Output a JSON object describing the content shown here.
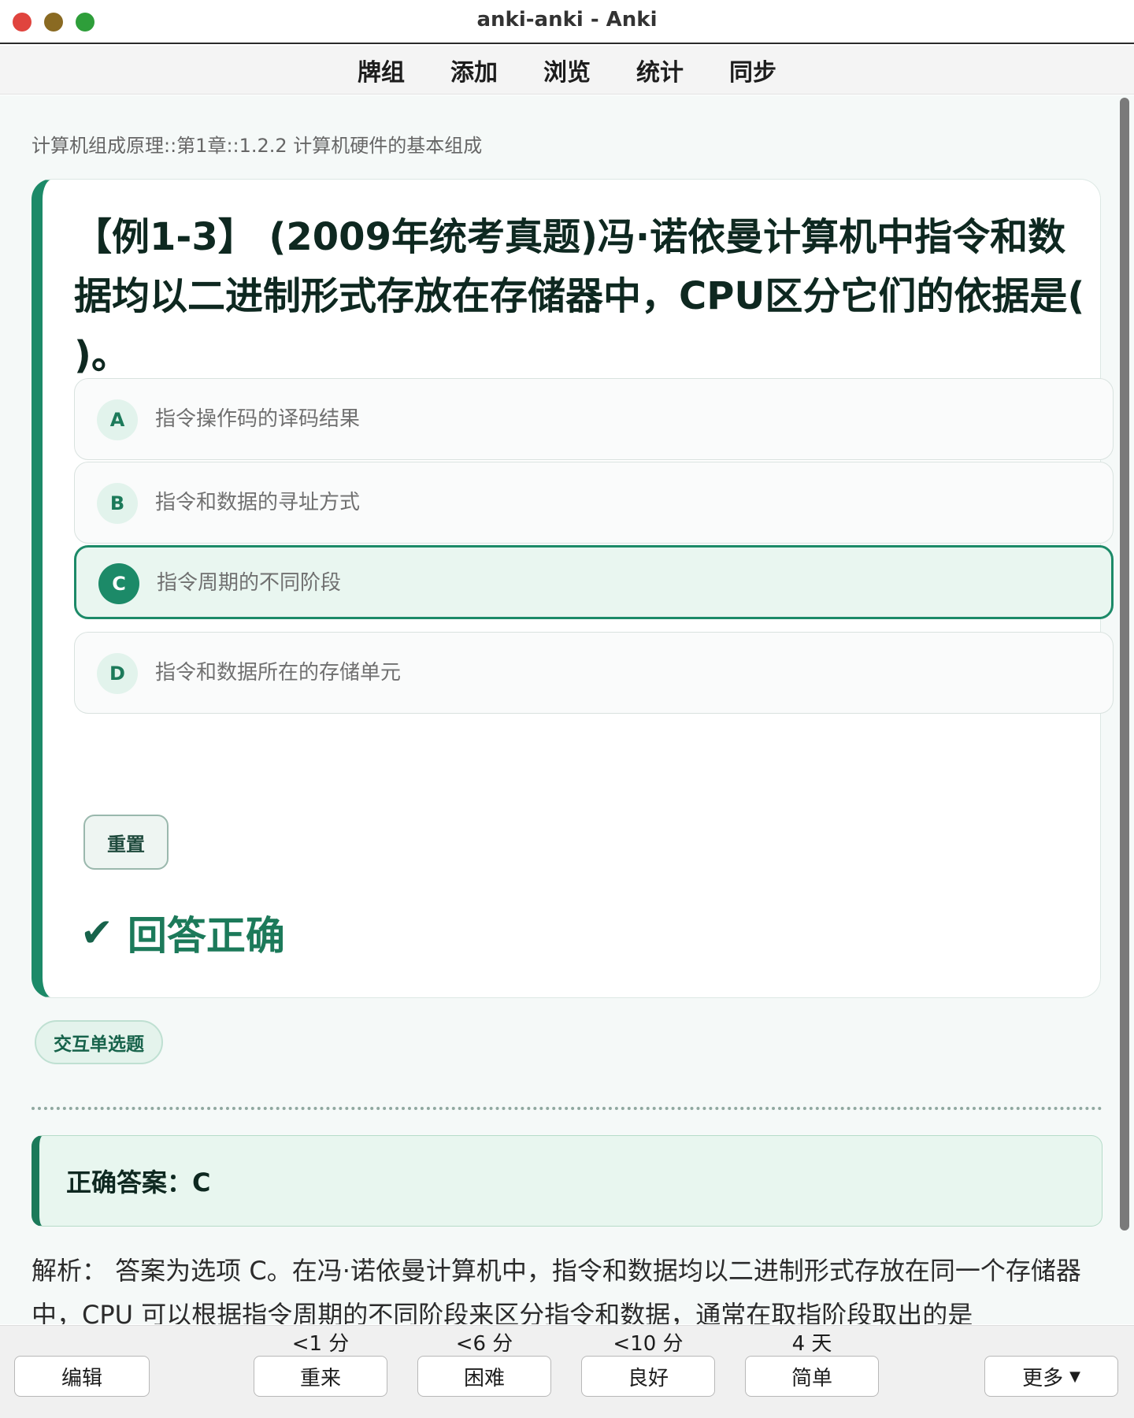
{
  "window": {
    "title": "anki-anki - Anki"
  },
  "toolbar": {
    "items": [
      "牌组",
      "添加",
      "浏览",
      "统计",
      "同步"
    ]
  },
  "card": {
    "breadcrumb": "计算机组成原理::第1章::1.2.2 计算机硬件的基本组成",
    "question": "【例1-3】 (2009年统考真题)冯·诺依曼计算机中指令和数据均以二进制形式存放在存储器中，CPU区分它们的依据是( )。",
    "options": [
      {
        "letter": "A",
        "text": "指令操作码的译码结果",
        "selected": false
      },
      {
        "letter": "B",
        "text": "指令和数据的寻址方式",
        "selected": false
      },
      {
        "letter": "C",
        "text": "指令周期的不同阶段",
        "selected": true
      },
      {
        "letter": "D",
        "text": "指令和数据所在的存储单元",
        "selected": false
      }
    ],
    "reset_label": "重置",
    "result_icon": "✔",
    "result_text": "回答正确",
    "tag": "交互单选题",
    "answer_label": "正确答案：C",
    "analysis": "解析： 答案为选项 C。在冯·诺依曼计算机中，指令和数据均以二进制形式存放在同一个存储器中，CPU 可以根据指令周期的不同阶段来区分指令和数据，通常在取指阶段取出的是"
  },
  "bottom": {
    "edit_label": "编辑",
    "more_label": "更多",
    "answers": [
      {
        "label": "重来",
        "due": "<1 分"
      },
      {
        "label": "困难",
        "due": "<6 分"
      },
      {
        "label": "良好",
        "due": "<10 分"
      },
      {
        "label": "简单",
        "due": "4 天"
      }
    ]
  },
  "colors": {
    "accent": "#1c8a68",
    "accent_dark": "#17634b",
    "selected_bg": "#e9f6f0"
  }
}
